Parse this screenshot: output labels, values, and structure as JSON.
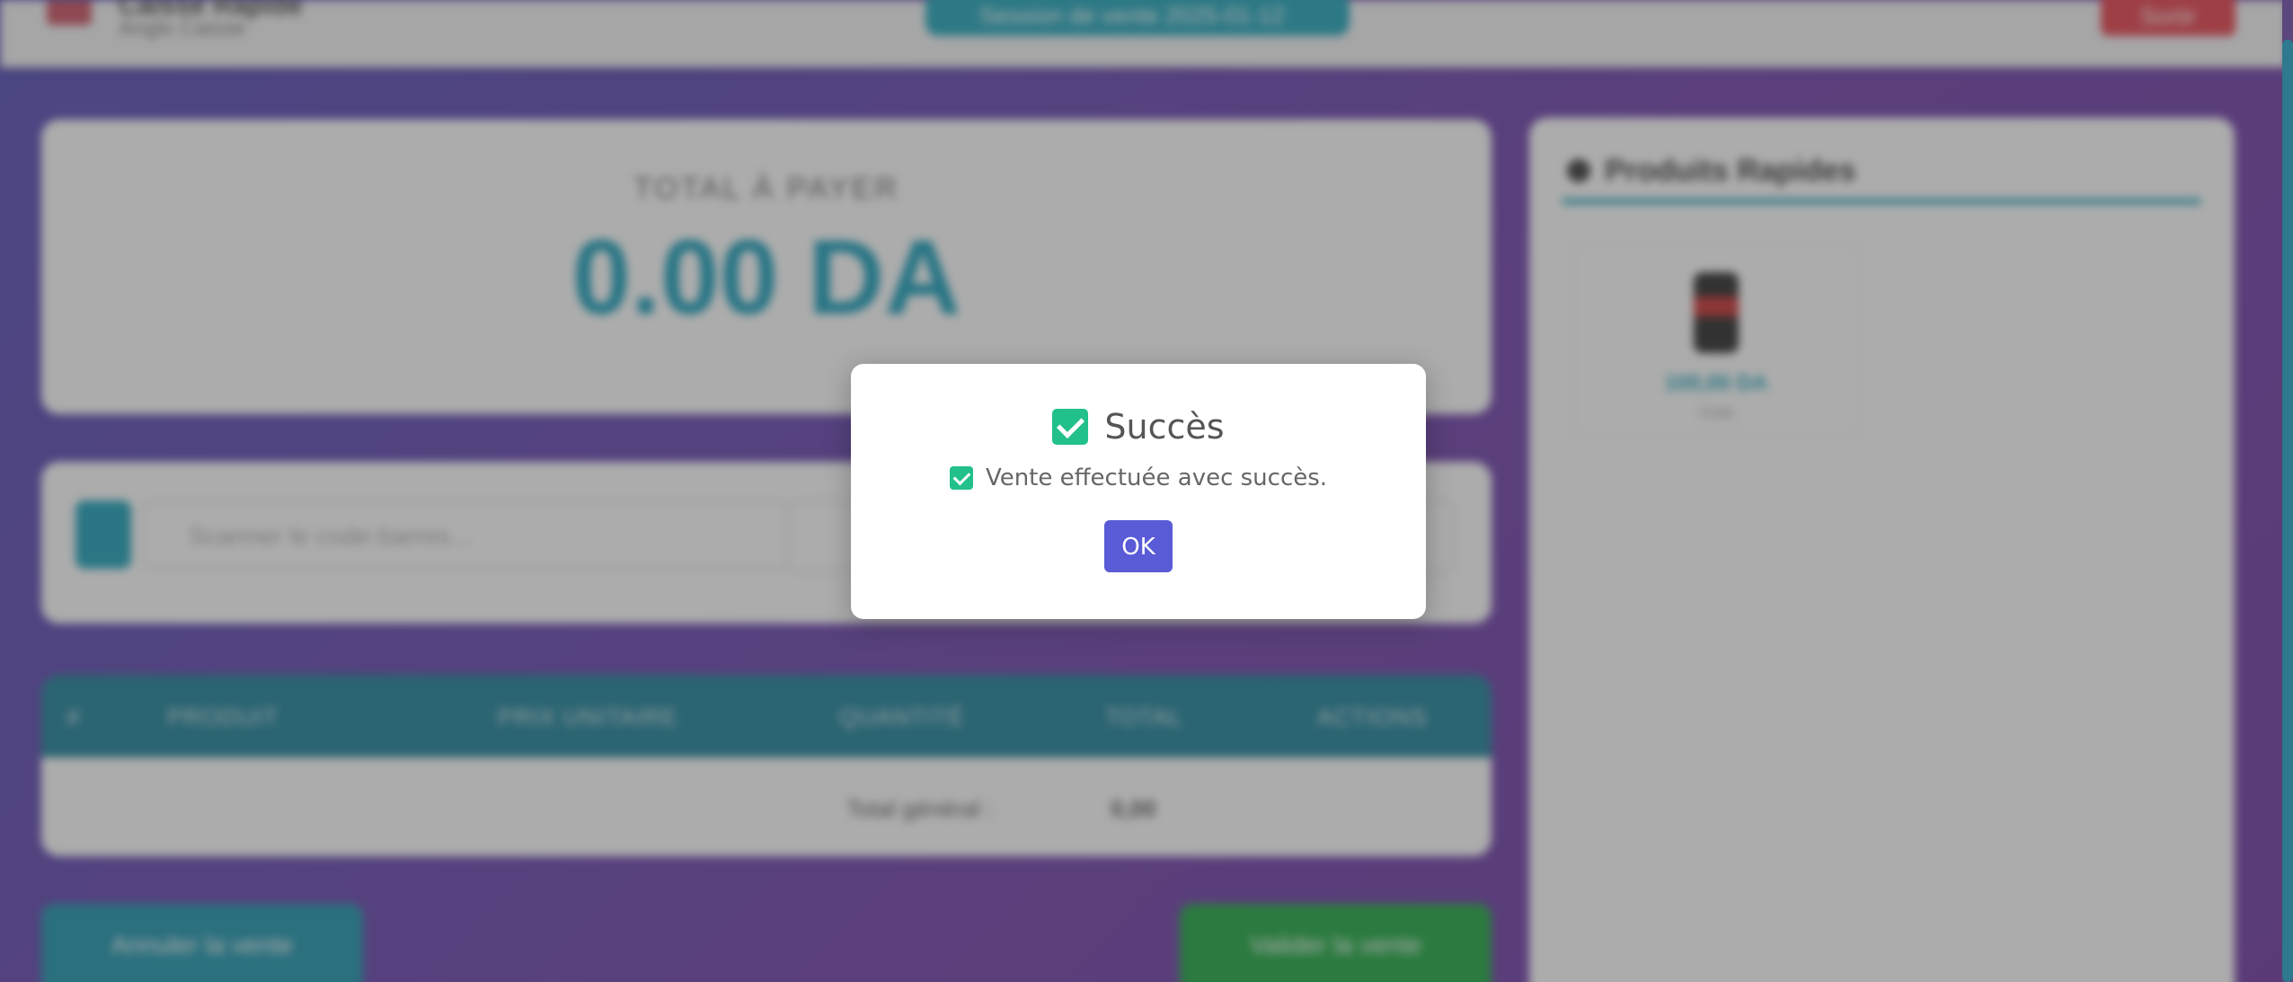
{
  "header": {
    "brand_title": "Caisse Rapide",
    "brand_subtitle": "Anglo Caisse",
    "session_label": "Session de vente 2025-01-12",
    "logout_label": "Sortir"
  },
  "total": {
    "label": "TOTAL À PAYER",
    "value": "0.00 DA"
  },
  "search": {
    "placeholder": "Scanner le code-barres..."
  },
  "table": {
    "headers": [
      "#",
      "PRODUIT",
      "PRIX UNITAIRE",
      "QUANTITÉ",
      "TOTAL",
      "ACTIONS"
    ],
    "total_general_label": "Total général :",
    "total_general_value": "0,00"
  },
  "actions": {
    "cancel_label": "Annuler la vente",
    "validate_label": "Valider la vente"
  },
  "quick_products": {
    "title": "Produits Rapides",
    "items": [
      {
        "price": "100,00 DA",
        "name": "Cola"
      }
    ]
  },
  "dialog": {
    "title": "Succès",
    "message": "Vente effectuée avec succès.",
    "ok_label": "OK",
    "accent_color": "#22c08a",
    "button_color": "#5a5bd6"
  }
}
